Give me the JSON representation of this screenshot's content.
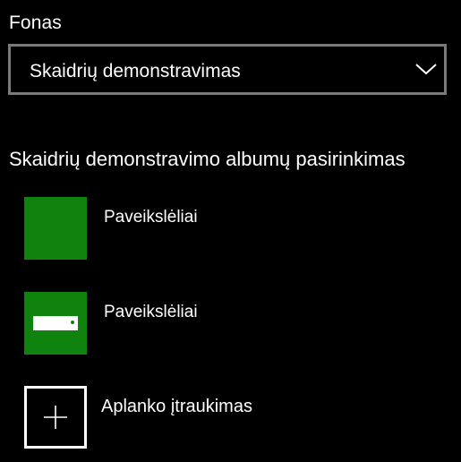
{
  "background": {
    "label": "Fonas",
    "dropdown": {
      "selected": "Skaidrių demonstravimas",
      "icon": "chevron-down-icon"
    }
  },
  "slideshow": {
    "heading": "Skaidrių demonstravimo albumų pasirinkimas",
    "albums": [
      {
        "name": "Paveikslėliai",
        "thumbnail": "green-tile"
      },
      {
        "name": "Paveikslėliai",
        "thumbnail": "green-tile-with-bar"
      }
    ],
    "add_folder_label": "Aplanko įtraukimas",
    "add_icon": "plus-icon"
  },
  "colors": {
    "accent": "#10830f",
    "background": "#000000",
    "text": "#ffffff",
    "border": "#7a7a7a"
  }
}
